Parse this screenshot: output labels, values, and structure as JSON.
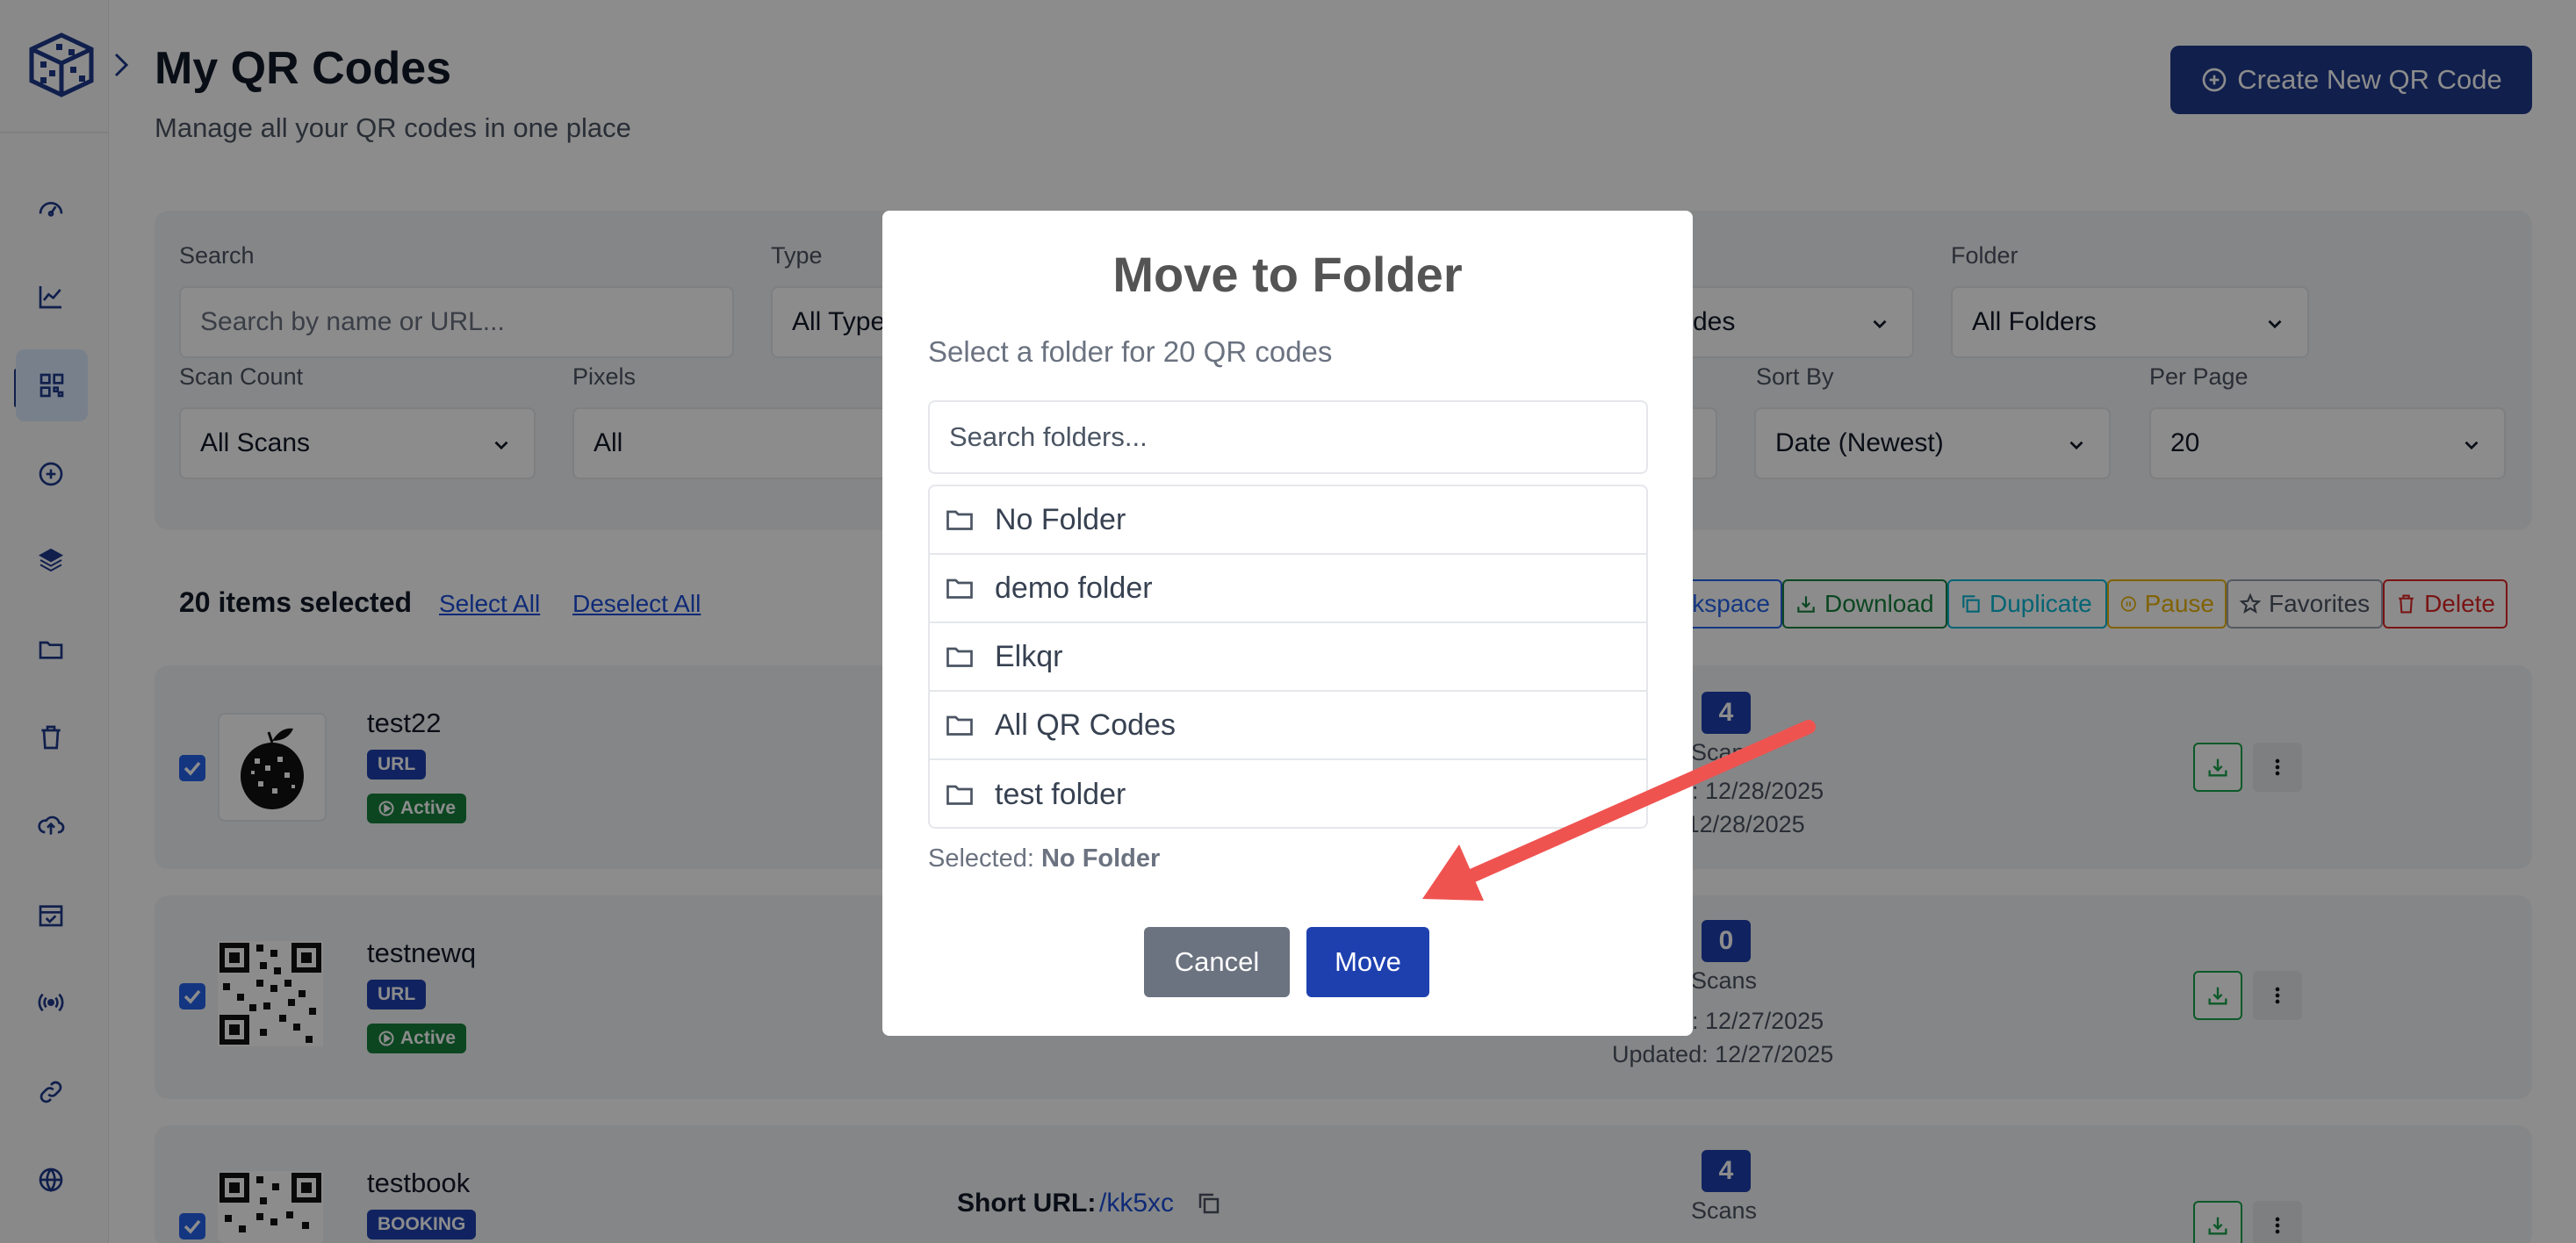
{
  "header": {
    "title": "My QR Codes",
    "subtitle": "Manage all your QR codes in one place",
    "create_label": "Create New QR Code"
  },
  "sidebar": {
    "items": [
      {
        "icon": "dashboard-icon"
      },
      {
        "icon": "analytics-icon"
      },
      {
        "icon": "qr-code-icon",
        "active": true
      },
      {
        "icon": "add-circle-icon"
      },
      {
        "icon": "layers-icon"
      },
      {
        "icon": "folder-icon"
      },
      {
        "icon": "trash-icon"
      },
      {
        "icon": "upload-cloud-icon"
      },
      {
        "icon": "calendar-check-icon"
      },
      {
        "icon": "broadcast-icon"
      },
      {
        "icon": "link-icon"
      },
      {
        "icon": "globe-icon"
      }
    ]
  },
  "filters": {
    "search_label": "Search",
    "search_placeholder": "Search by name or URL...",
    "type_label": "Type",
    "type_value": "All Type",
    "status_value": "des",
    "folder_label": "Folder",
    "folder_value": "All Folders",
    "scan_count_label": "Scan Count",
    "scan_count_value": "All Scans",
    "pixels_label": "Pixels",
    "pixels_value": "All",
    "sort_label": "Sort By",
    "sort_value": "Date (Newest)",
    "per_page_label": "Per Page",
    "per_page_value": "20"
  },
  "bulk": {
    "count_text": "20 items selected",
    "select_all": "Select All",
    "deselect_all": "Deselect All",
    "workspace": "kspace",
    "download": "Download",
    "duplicate": "Duplicate",
    "pause": "Pause",
    "favorites": "Favorites",
    "delete": "Delete"
  },
  "rows": [
    {
      "name": "test22",
      "type": "URL",
      "status": "Active",
      "scans": "4",
      "scans_label": "Scan",
      "created": "d: 12/28/2025",
      "updated": "dated: 12/28/2025"
    },
    {
      "name": "testnewq",
      "type": "URL",
      "status": "Active",
      "scans": "0",
      "scans_label": "Scans",
      "created": "d: 12/27/2025",
      "updated": "Updated: 12/27/2025"
    },
    {
      "name": "testbook",
      "type": "BOOKING",
      "short_url_label": "Short URL:",
      "short_url": "/kk5xc",
      "scans": "4",
      "scans_label": "Scans"
    }
  ],
  "modal": {
    "title": "Move to Folder",
    "subtitle": "Select a folder for 20 QR codes",
    "search_placeholder": "Search folders...",
    "folders": [
      "No Folder",
      "demo folder",
      "Elkqr",
      "All QR Codes",
      "test folder"
    ],
    "selected_label": "Selected:",
    "selected_value": "No Folder",
    "cancel_label": "Cancel",
    "move_label": "Move"
  },
  "colors": {
    "primary": "#1e3a8a",
    "cancel": "#6b7280",
    "arrow": "#ef5350",
    "active_green": "#15803d"
  }
}
